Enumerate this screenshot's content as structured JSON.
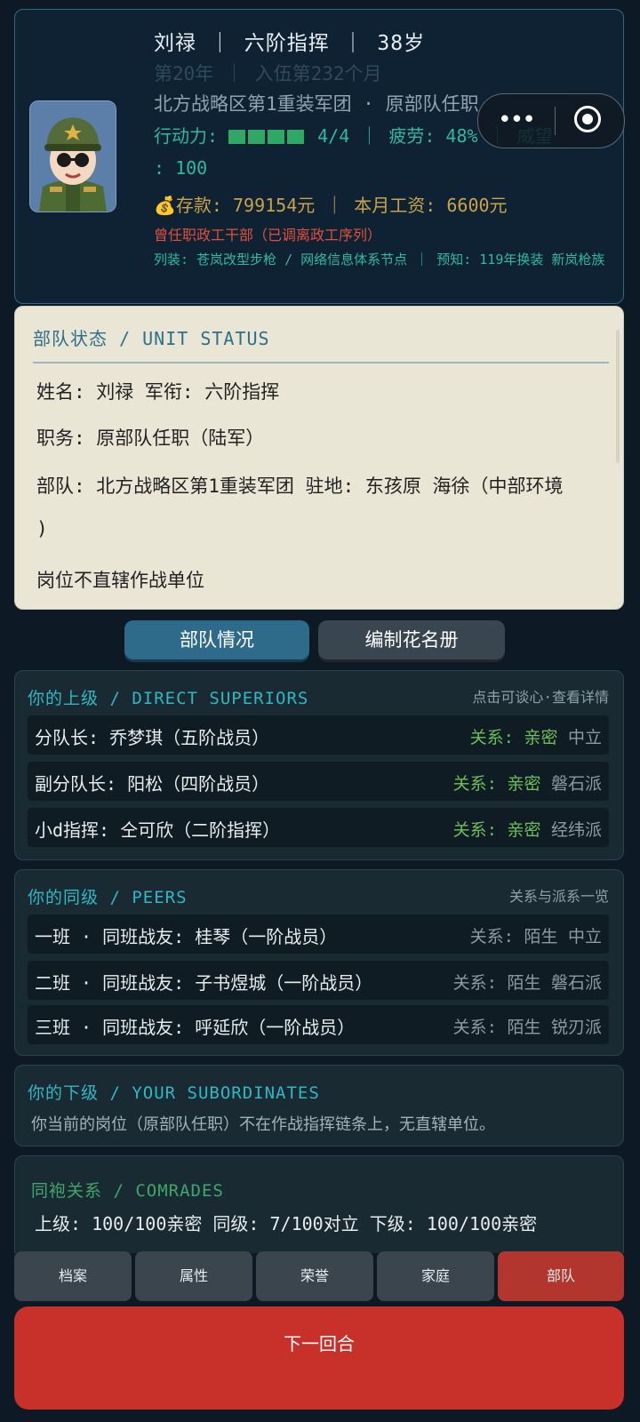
{
  "header": {
    "name_line": "刘禄  ｜  六阶指挥  ｜  38岁",
    "service_line": "第20年  ｜  入伍第232个月",
    "unit_line": "北方战略区第1重装军团  ·  原部队任职",
    "action_label": "行动力:",
    "action_value": "4/4",
    "action_points": 4,
    "fatigue": "｜  疲劳: 48%  ｜  威望",
    "prestige_value": ": 100",
    "money": "💰存款: 799154元  ｜  本月工资: 6600元",
    "warning": "曾任职政工干部（已调离政工序列）",
    "equipment": "列装: 苍岚改型步枪 / 网络信息体系节点  ｜  预知: 119年换装 新岚枪族",
    "colors": {
      "accent": "#2fb8a6",
      "money": "#c9a24a",
      "warning": "#e0503c"
    }
  },
  "capsule": {
    "more_icon": "more-dots-icon",
    "record_icon": "record-circle-icon"
  },
  "unit_status": {
    "title": "部队状态 / UNIT STATUS",
    "name_rank": "姓名: 刘禄  军衔: 六阶指挥",
    "duty": "职务: 原部队任职（陆军）",
    "unit": "部队: 北方战略区第1重装军团  驻地: 东孩原 海徐（中部环境",
    "unit_cont": ")",
    "note": "岗位不直辖作战单位"
  },
  "tabs": {
    "active": "部队情况",
    "inactive": "编制花名册"
  },
  "superiors": {
    "title": "你的上级 / DIRECT SUPERIORS",
    "hint": "点击可谈心·查看详情",
    "rows": [
      {
        "name": "分队长: 乔梦琪（五阶战员）",
        "relation": "关系: 亲密",
        "faction": "中立"
      },
      {
        "name": "副分队长: 阳松（四阶战员）",
        "relation": "关系: 亲密",
        "faction": "磐石派"
      },
      {
        "name": "小d指挥: 仝可欣（二阶指挥）",
        "relation": "关系: 亲密",
        "faction": "经纬派"
      }
    ]
  },
  "peers": {
    "title": "你的同级 / PEERS",
    "hint": "关系与派系一览",
    "rows": [
      {
        "name": "一班  ·  同班战友: 桂琴（一阶战员）",
        "relation": "关系: 陌生",
        "faction": "中立"
      },
      {
        "name": "二班  ·  同班战友: 子书煜城（一阶战员）",
        "relation": "关系: 陌生",
        "faction": "磐石派"
      },
      {
        "name": "三班  ·  同班战友: 呼延欣（一阶战员）",
        "relation": "关系: 陌生",
        "faction": "锐刃派"
      }
    ]
  },
  "subordinates": {
    "title": "你的下级 / YOUR SUBORDINATES",
    "text": "你当前的岗位（原部队任职）不在作战指挥链条上，无直辖单位。"
  },
  "comrades": {
    "title": "同袍关系 / COMRADES",
    "line": "上级: 100/100亲密  同级: 7/100对立  下级: 100/100亲密"
  },
  "nav": [
    "档案",
    "属性",
    "荣誉",
    "家庭",
    "部队"
  ],
  "next_button": "下一回合"
}
